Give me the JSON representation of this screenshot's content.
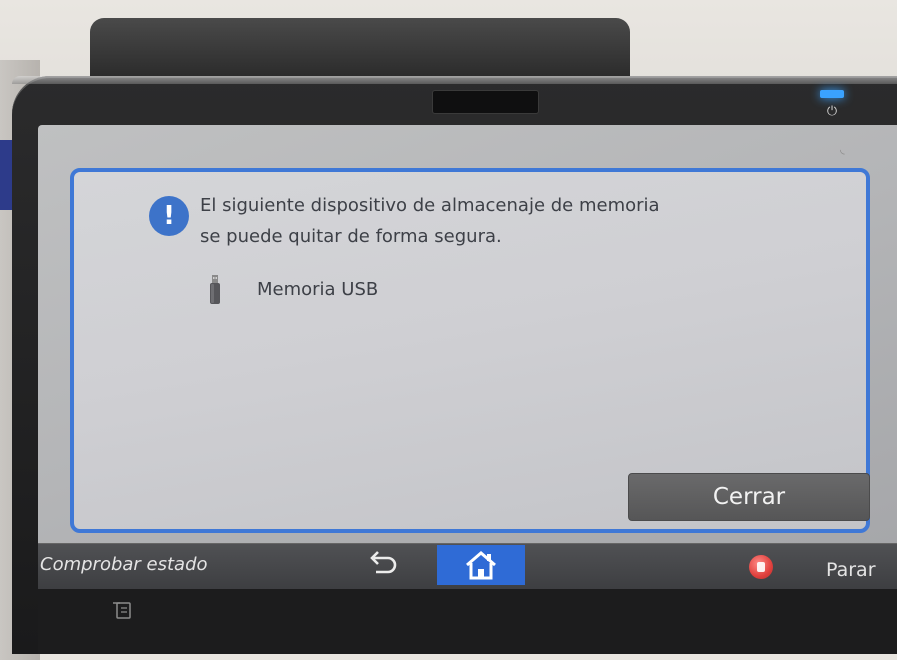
{
  "dialog": {
    "message_line1": "El siguiente dispositivo de almacenaje de memoria",
    "message_line2": "se puede quitar de forma segura.",
    "device_label": "Memoria USB",
    "close_label": "Cerrar",
    "icon": "info-exclamation-icon",
    "border_color": "#3f78d6"
  },
  "bottom_bar": {
    "status_label": "Comprobar estado",
    "back_icon": "back-arrow-icon",
    "home_icon": "home-icon",
    "stop_icon": "stop-icon",
    "stop_label": "Parar",
    "home_color": "#2f6bd6",
    "stop_color": "#e0403d"
  },
  "bezel": {
    "led_color": "#3aa2ff",
    "energy_icon": "energy-saver-icon",
    "card_icon": "card-reader-icon"
  }
}
